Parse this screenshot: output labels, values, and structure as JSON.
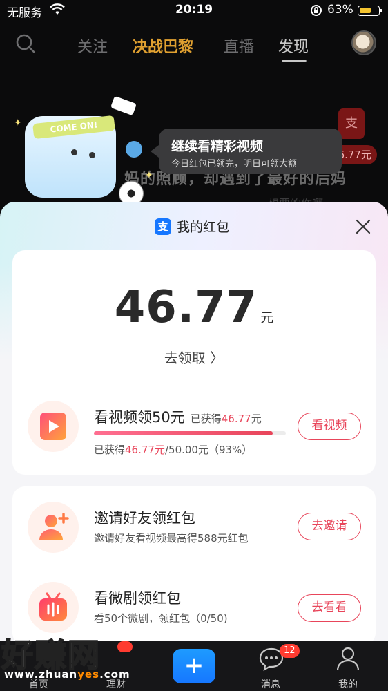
{
  "status_bar": {
    "carrier": "无服务",
    "time": "20:19",
    "battery_pct": "63%",
    "battery_level": 0.63
  },
  "top_nav": {
    "tabs": [
      "关注",
      "决战巴黎",
      "直播",
      "发现"
    ],
    "active_tab": "发现"
  },
  "background": {
    "caption": "妈的照顾，却遇到了最好的后妈",
    "caption2": "想要的你啊",
    "redpack_icon_glyph": "支",
    "redpack_amount": "46.77元",
    "mascot_band": "COME ON!"
  },
  "bubble": {
    "title": "继续看精彩视频",
    "subtitle": "今日红包已领完，明日可领大额"
  },
  "panel": {
    "logo_glyph": "支",
    "title": "我的红包",
    "amount": "46.77",
    "unit": "元",
    "claim": "去领取 〉",
    "tasks": [
      {
        "title": "看视频领50元",
        "earned_prefix": "已获得",
        "earned_value": "46.77",
        "earned_unit": "元",
        "progress_prefix": "已获得",
        "progress_value": "46.77元",
        "progress_suffix": "/50.00元（93%）",
        "progress_fraction": 0.93,
        "button": "看视频"
      },
      {
        "title": "邀请好友领红包",
        "subtitle": "邀请好友看视频最高得588元红包",
        "button": "去邀请"
      },
      {
        "title": "看微剧领红包",
        "subtitle": "看50个微剧，领红包（0/50)",
        "button": "去看看"
      }
    ]
  },
  "tab_bar": {
    "items": [
      "首页",
      "理财",
      "消息",
      "我的"
    ],
    "plus": "+",
    "message_badge": "12"
  },
  "watermark": {
    "big": "好赚网",
    "url_a": "www.zhuan",
    "url_b": "yes",
    "url_c": ".com"
  },
  "colors": {
    "accent_red": "#e8455a",
    "alipay_blue": "#1677ff",
    "special_tab": "#e0a030"
  }
}
